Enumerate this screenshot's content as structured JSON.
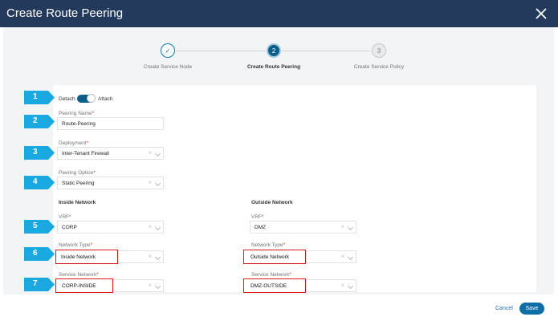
{
  "window": {
    "title": "Create Route Peering",
    "close_icon": "close-icon"
  },
  "stepper": {
    "steps": [
      {
        "label": "Create Service Node",
        "marker": "✓",
        "state": "completed"
      },
      {
        "label": "Create Route Peering",
        "marker": "2",
        "state": "active"
      },
      {
        "label": "Create Service Policy",
        "marker": "3",
        "state": "upcoming"
      }
    ]
  },
  "callouts": [
    "1",
    "2",
    "3",
    "4",
    "5",
    "6",
    "7"
  ],
  "form": {
    "attach_toggle": {
      "left_label": "Detach",
      "right_label": "Attach",
      "state": "Attach"
    },
    "peering_name": {
      "label": "Peering Name",
      "required": "*",
      "value": "Route-Peering"
    },
    "deployment": {
      "label": "Deployment",
      "required": "*",
      "value": "Inter-Tenant Firewall"
    },
    "peering_option": {
      "label": "Peering Option",
      "required": "*",
      "value": "Static Peering"
    },
    "inside": {
      "heading": "Inside Network",
      "vrf": {
        "label": "VRF",
        "required": "*",
        "value": "CORP"
      },
      "network_type": {
        "label": "Network Type",
        "required": "*",
        "value": "Inside Network"
      },
      "service_network": {
        "label": "Service Network",
        "required": "*",
        "value": "CORP-INSIDE"
      }
    },
    "outside": {
      "heading": "Outside Network",
      "vrf": {
        "label": "VRF",
        "required": "*",
        "value": "DMZ"
      },
      "network_type": {
        "label": "Network Type",
        "required": "*",
        "value": "Outside Network"
      },
      "service_network": {
        "label": "Service Network",
        "required": "*",
        "value": "DMZ-OUTSIDE"
      }
    }
  },
  "footer": {
    "cancel_label": "Cancel",
    "save_label": "Save"
  },
  "colors": {
    "title_bar": "#233a5c",
    "accent": "#0f6ea5",
    "callout": "#19a9e0",
    "highlight": "#d9161a"
  }
}
